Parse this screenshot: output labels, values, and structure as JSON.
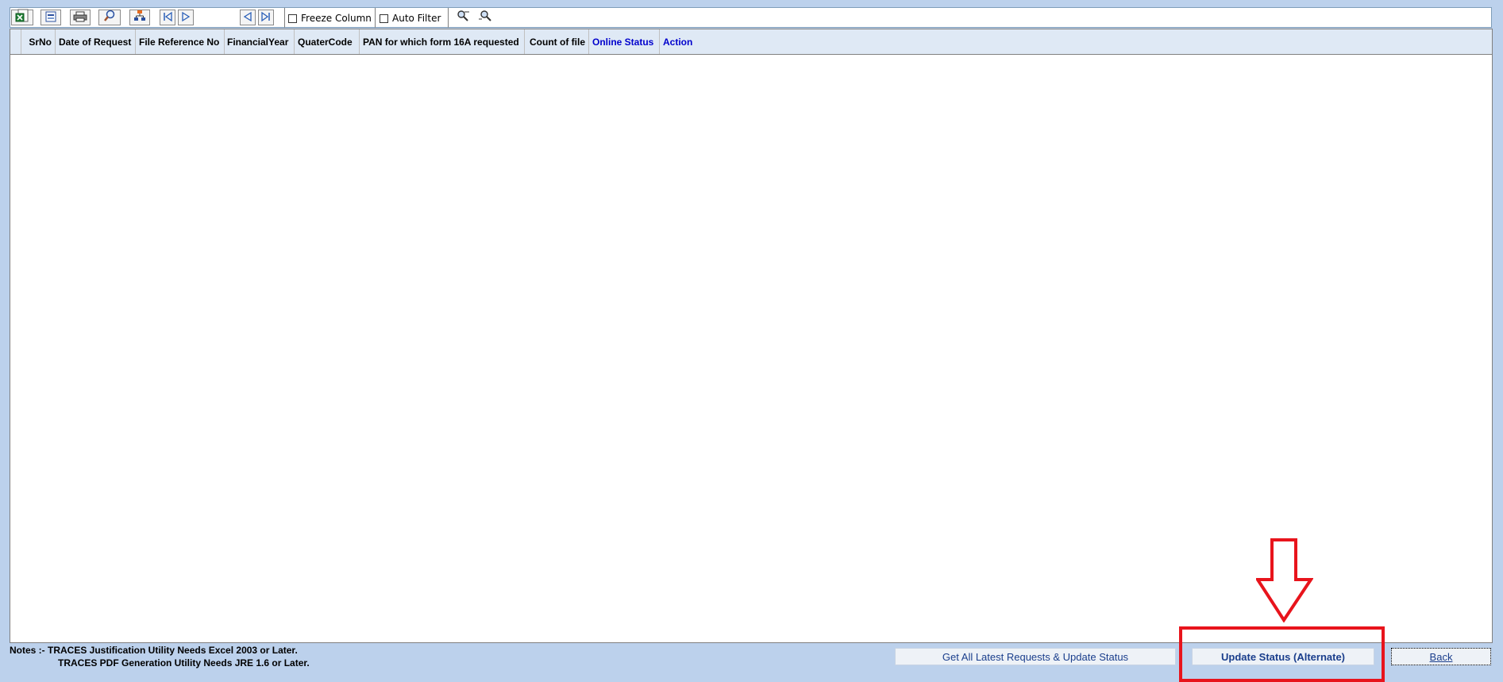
{
  "toolbar": {
    "icons": [
      "excel-export-icon",
      "document-icon",
      "print-icon",
      "preview-icon",
      "hierarchy-icon",
      "first-page-icon",
      "next-page-icon",
      "previous-icon",
      "last-icon",
      "find-icon",
      "find-next-icon"
    ],
    "freeze_column_label": "Freeze Column",
    "auto_filter_label": "Auto Filter"
  },
  "grid": {
    "columns": [
      "SrNo",
      "Date of Request",
      "File Reference No",
      "FinancialYear",
      "QuaterCode",
      "PAN for which form 16A requested",
      "Count of file",
      "Online Status",
      "Action"
    ],
    "rows": []
  },
  "notes": {
    "line1": "Notes :- TRACES Justification Utility Needs Excel 2003 or Later.",
    "line2": "TRACES PDF Generation Utility Needs JRE 1.6 or Later."
  },
  "buttons": {
    "get_all": "Get All Latest Requests & Update Status",
    "update_alternate": "Update Status (Alternate)",
    "back": "Back"
  },
  "colors": {
    "background": "#bcd1ec",
    "header": "#dfe9f5",
    "link": "#0000cc",
    "annotation": "#e8141c"
  }
}
